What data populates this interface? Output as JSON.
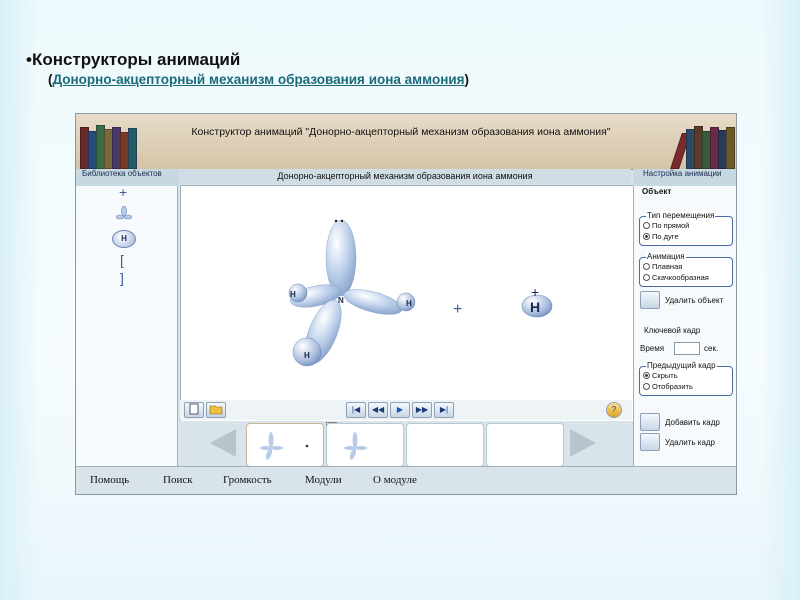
{
  "slide": {
    "title": "•Конструкторы анимаций",
    "subtitle_open": "(",
    "subtitle_link": "Донорно-акцепторный механизм образования иона аммония",
    "subtitle_close": ")"
  },
  "app": {
    "window_title": "Конструктор анимаций \"Донорно-акцепторный механизм образования иона аммония\"",
    "library": {
      "header": "Библиотека объектов",
      "items": [
        "+",
        "⅄",
        "H",
        "[",
        "]"
      ]
    },
    "canvas": {
      "header": "Донорно-акцепторный механизм образования иона аммония",
      "plus_sign": "+",
      "ion_charge": "+",
      "ion_symbol": "H",
      "nitrogen_symbol": "N",
      "hydrogen_symbol": "H"
    },
    "frames": {
      "number_label": "2c"
    },
    "settings": {
      "header": "Настройка анимации",
      "object_label": "Объект",
      "move_type": {
        "label": "Тип перемещения",
        "options": [
          "По прямой",
          "По дуге"
        ],
        "selected": "По дуге"
      },
      "animation": {
        "label": "Анимация",
        "options": [
          "Плавная",
          "Скачкообразная"
        ],
        "selected": ""
      },
      "delete_object": "Удалить объект",
      "keyframe_label": "Ключевой кадр",
      "time_label": "Время",
      "time_unit": "сек.",
      "prev_frame": {
        "label": "Предыдущий кадр",
        "options": [
          "Скрыть",
          "Отобразить"
        ],
        "selected": "Скрыть"
      },
      "add_frame": "Добавить кадр",
      "delete_frame": "Удалить кадр"
    },
    "menu": [
      "Помощь",
      "Поиск",
      "Громкость",
      "Модули",
      "О модуле"
    ]
  },
  "colors": {
    "orbital": "#b8cce8",
    "accent_blue": "#3c5f8e",
    "titlebar": "#d4c4a8"
  }
}
